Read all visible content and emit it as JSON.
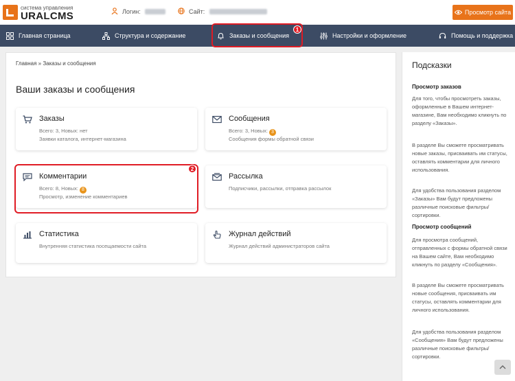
{
  "header": {
    "logo_subtitle": "система управления",
    "logo_title": "URALCMS",
    "login_label": "Логин:",
    "site_label": "Сайт:",
    "preview_button": "Просмотр сайта",
    "accent_color": "#e8731a"
  },
  "nav": {
    "items": [
      {
        "label": "Главная страница",
        "icon": "grid-icon"
      },
      {
        "label": "Структура и содержание",
        "icon": "sitemap-icon"
      },
      {
        "label": "Заказы и сообщения",
        "icon": "bell-icon"
      },
      {
        "label": "Настройки и оформление",
        "icon": "sliders-icon"
      },
      {
        "label": "Помощь и поддержка",
        "icon": "headset-icon"
      }
    ],
    "badge_1": "1"
  },
  "main": {
    "breadcrumb": "Главная » Заказы и сообщения",
    "title": "Ваши заказы и сообщения",
    "cards": [
      {
        "title": "Заказы",
        "stats": "Всего: 3, Новых: нет",
        "new_badge": "",
        "desc": "Заявки каталога, интернет-магазина",
        "icon": "cart-icon"
      },
      {
        "title": "Сообщения",
        "stats": "Всего: 3, Новых:",
        "new_badge": "3",
        "desc": "Сообщения формы обратной связи",
        "icon": "envelope-icon"
      },
      {
        "title": "Комментарии",
        "stats": "Всего: 8, Новых:",
        "new_badge": "8",
        "desc": "Просмотр, изменение комментариев",
        "icon": "comment-icon"
      },
      {
        "title": "Рассылка",
        "stats": "",
        "new_badge": "",
        "desc": "Подписчики, рассылки, отправка рассылок",
        "icon": "newsletter-icon"
      },
      {
        "title": "Статистика",
        "stats": "",
        "new_badge": "",
        "desc": "Внутренняя статистика посещаемости сайта",
        "icon": "chart-icon"
      },
      {
        "title": "Журнал действий",
        "stats": "",
        "new_badge": "",
        "desc": "Журнал действий администраторов сайта",
        "icon": "pointer-icon"
      }
    ],
    "badge_2": "2"
  },
  "sidebar": {
    "title": "Подсказки",
    "sections": [
      {
        "heading": "Просмотр заказов",
        "paragraphs": [
          "Для того, чтобы просмотреть заказы, оформленные в Вашем интернет-магазине, Вам необходимо кликнуть по разделу «Заказы».",
          "В разделе Вы сможете просматривать новые заказы, присваивать им статусы, оставлять комментарии для личного использования.",
          "Для удобства пользования разделом «Заказы» Вам будут предложены различные поисковые фильтры/сортировки."
        ]
      },
      {
        "heading": "Просмотр сообщений",
        "paragraphs": [
          "Для просмотра сообщений, отправленных с формы обратной связи на Вашем сайте, Вам необходимо кликнуть по разделу «Сообщения».",
          "В разделе Вы сможете просматривать новые сообщения, присваивать им статусы, оставлять комментарии для личного использования.",
          "Для удобства пользования разделом «Сообщения» Вам будут предложены различные поисковые фильтры/сортировки."
        ]
      }
    ]
  }
}
